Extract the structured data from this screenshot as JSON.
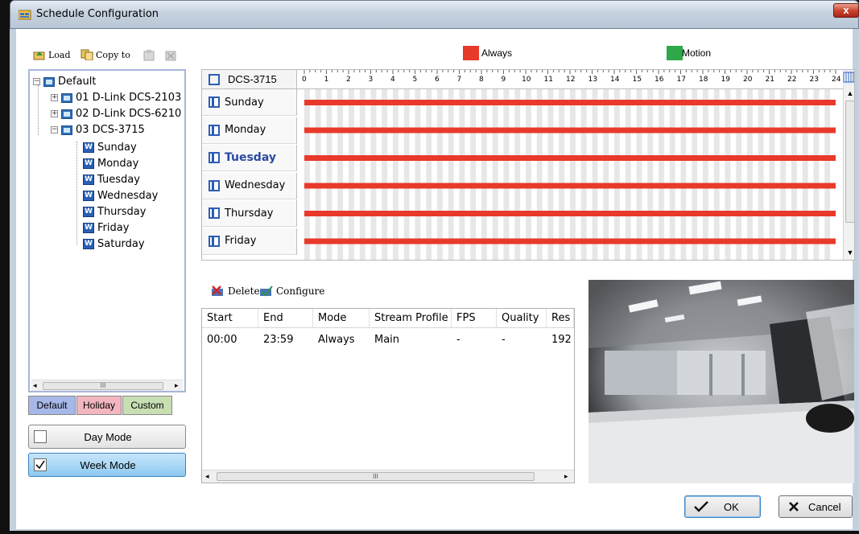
{
  "window": {
    "title": "Schedule Configuration",
    "close_glyph": "x"
  },
  "toolbar": {
    "load_label": "Load",
    "copy_to_label": "Copy to"
  },
  "tree": {
    "root": "Default",
    "cameras": [
      "01 D-Link DCS-2103",
      "02 D-Link DCS-6210",
      "03 DCS-3715"
    ],
    "days": [
      "Sunday",
      "Monday",
      "Tuesday",
      "Wednesday",
      "Thursday",
      "Friday",
      "Saturday"
    ],
    "day_icon_letter": "W",
    "scroll_thumb": "III"
  },
  "tabs": [
    "Default",
    "Holiday",
    "Custom"
  ],
  "modes": {
    "day_mode": "Day Mode",
    "week_mode": "Week Mode",
    "week_mode_checked": true,
    "day_mode_checked": false
  },
  "legend": [
    {
      "label": "Always",
      "color": "#e8392a"
    },
    {
      "label": "Motion",
      "color": "#2fa84a"
    }
  ],
  "schedule": {
    "camera": "DCS-3715",
    "hours": [
      "0",
      "1",
      "2",
      "3",
      "4",
      "5",
      "6",
      "7",
      "8",
      "9",
      "10",
      "11",
      "12",
      "13",
      "14",
      "15",
      "16",
      "17",
      "18",
      "19",
      "20",
      "21",
      "22",
      "23",
      "24"
    ],
    "rows": [
      {
        "day": "Sunday",
        "start": "00:00",
        "end": "23:59",
        "mode": "Always",
        "selected": false
      },
      {
        "day": "Monday",
        "start": "00:00",
        "end": "23:59",
        "mode": "Always",
        "selected": false
      },
      {
        "day": "Tuesday",
        "start": "00:00",
        "end": "23:59",
        "mode": "Always",
        "selected": true
      },
      {
        "day": "Wednesday",
        "start": "00:00",
        "end": "23:59",
        "mode": "Always",
        "selected": false
      },
      {
        "day": "Thursday",
        "start": "00:00",
        "end": "23:59",
        "mode": "Always",
        "selected": false
      },
      {
        "day": "Friday",
        "start": "00:00",
        "end": "23:59",
        "mode": "Always",
        "selected": false
      }
    ]
  },
  "actions": {
    "delete_label": "Delete",
    "configure_label": "Configure"
  },
  "table": {
    "columns": [
      "Start",
      "End",
      "Mode",
      "Stream Profile",
      "FPS",
      "Quality",
      "Res"
    ],
    "rows": [
      [
        "00:00",
        "23:59",
        "Always",
        "Main",
        "-",
        "-",
        "192"
      ]
    ],
    "scroll_thumb": "III"
  },
  "buttons": {
    "ok": "OK",
    "cancel": "Cancel"
  }
}
